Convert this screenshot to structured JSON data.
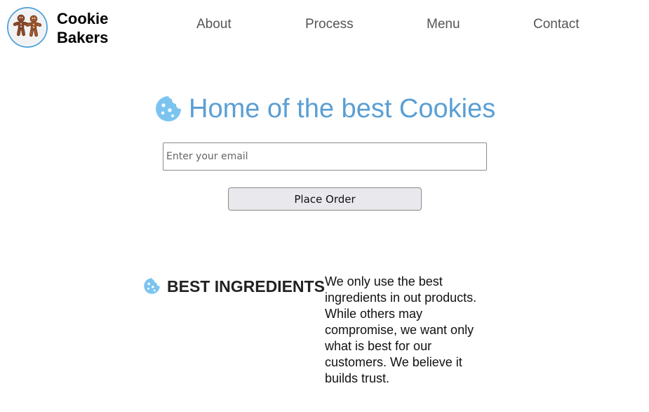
{
  "brand": {
    "name_line1": "Cookie",
    "name_line2": "Bakers",
    "logo_icon": "gingerbread-men-icon"
  },
  "nav": {
    "items": [
      {
        "label": "About"
      },
      {
        "label": "Process"
      },
      {
        "label": "Menu"
      },
      {
        "label": "Contact"
      }
    ]
  },
  "hero": {
    "title": "Home of the best Cookies",
    "icon": "cookie-icon",
    "email_placeholder": "Enter your email",
    "email_value": "",
    "button_label": "Place Order"
  },
  "features": [
    {
      "icon": "cookie-icon",
      "heading": "BEST INGREDIENTS",
      "text": "We only use the best ingredients in out products. While others may compromise, we want only what is best for our customers. We believe it builds trust."
    }
  ],
  "colors": {
    "accent": "#5a9fd4",
    "cookie_icon": "#7cc4f0",
    "logo_ring": "#5aa6dc",
    "nav_text": "#555555",
    "button_bg": "#e9e9ed"
  }
}
